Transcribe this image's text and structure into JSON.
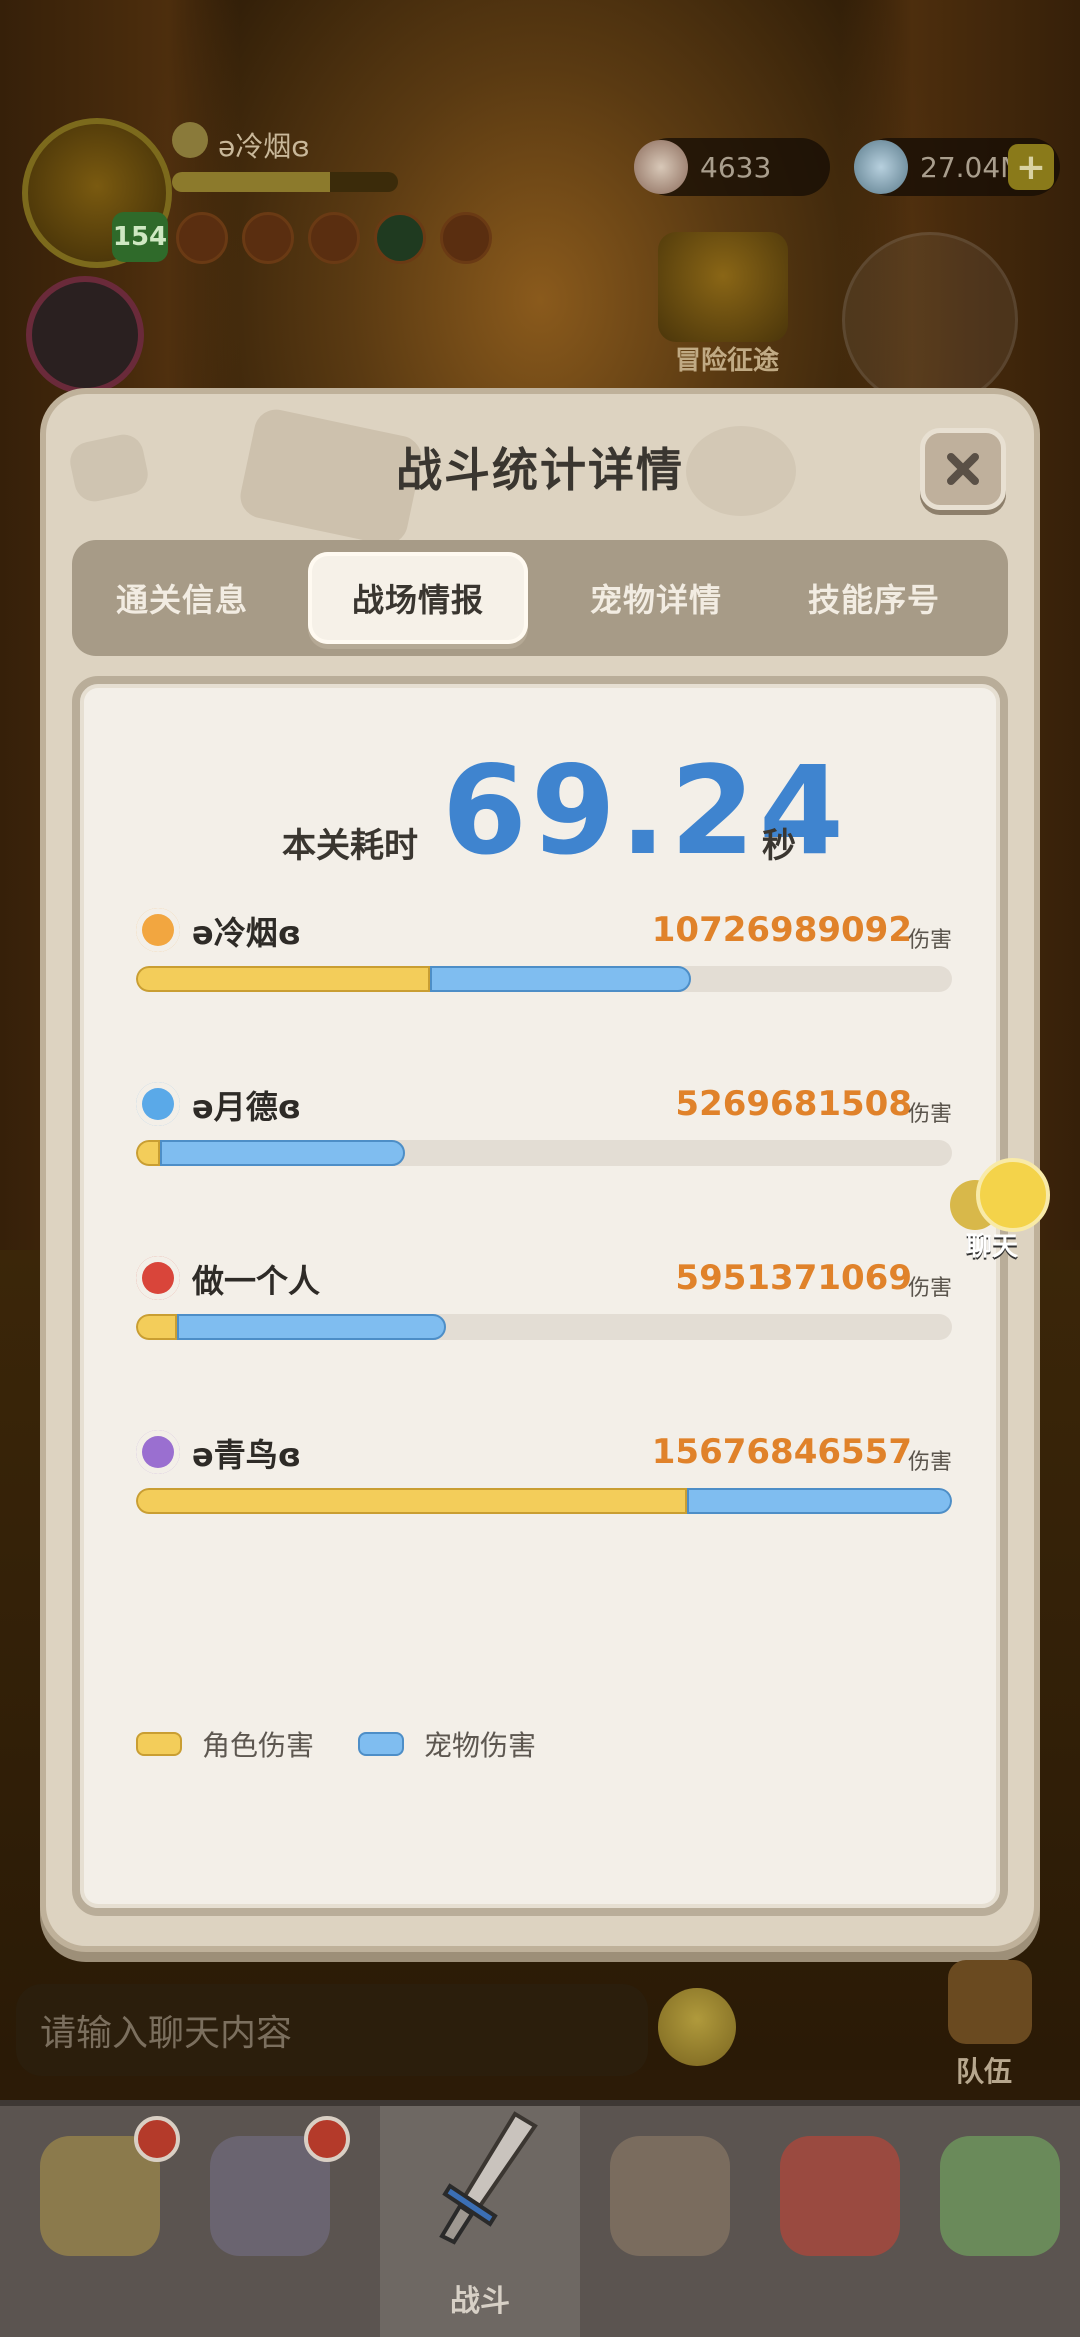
{
  "hud": {
    "player_name": "ə冷烟ɞ",
    "level": "154",
    "resource_1": "4633",
    "resource_2": "27.04M",
    "adventure_label": "冒险征途"
  },
  "modal": {
    "title": "战斗统计详情",
    "tabs": [
      {
        "label": "通关信息",
        "active": false
      },
      {
        "label": "战场情报",
        "active": true
      },
      {
        "label": "宠物详情",
        "active": false
      },
      {
        "label": "技能序号",
        "active": false
      }
    ],
    "time_label": "本关耗时",
    "time_value": "69.24",
    "time_unit": "秒",
    "damage_unit": "伤害",
    "players": [
      {
        "name": "ə冷烟ɞ",
        "damage": "10726989092",
        "role_fraction": 0.36,
        "pet_fraction": 0.32,
        "icon_color": "#f2a640"
      },
      {
        "name": "ə月德ɞ",
        "damage": "5269681508",
        "role_fraction": 0.03,
        "pet_fraction": 0.3,
        "icon_color": "#5aa9e8"
      },
      {
        "name": "做一个人",
        "damage": "5951371069",
        "role_fraction": 0.05,
        "pet_fraction": 0.33,
        "icon_color": "#d9453a"
      },
      {
        "name": "ə青鸟ɞ",
        "damage": "15676846557",
        "role_fraction": 0.675,
        "pet_fraction": 0.325,
        "icon_color": "#9a6fd0"
      }
    ],
    "legend": {
      "role": "角色伤害",
      "pet": "宠物伤害",
      "role_color": "#f3cd5a",
      "pet_color": "#7fbdf0"
    }
  },
  "chat_float_label": "聊天",
  "chat": {
    "placeholder": "请输入聊天内容"
  },
  "team_label": "队伍",
  "nav": {
    "battle_label": "战斗"
  }
}
